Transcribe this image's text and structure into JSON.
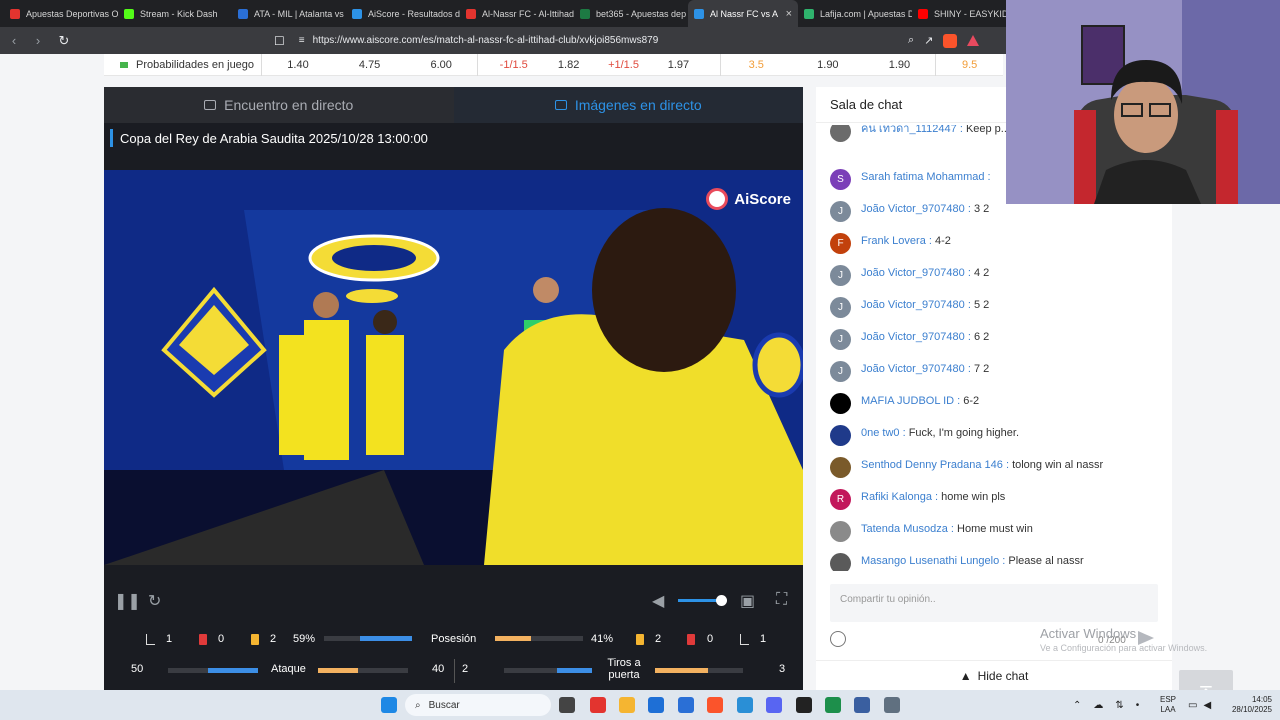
{
  "browser": {
    "tabs": [
      {
        "label": "Apuestas Deportivas O",
        "color": "#e3342f"
      },
      {
        "label": "Stream - Kick Dash",
        "color": "#53fc18"
      },
      {
        "label": "ATA - MIL | Atalanta vs",
        "color": "#2a6fd6"
      },
      {
        "label": "AiScore - Resultados d",
        "color": "#2d92e6"
      },
      {
        "label": "Al-Nassr FC - Al-Ittihad",
        "color": "#e3342f"
      },
      {
        "label": "bet365 - Apuestas dep",
        "color": "#1d7a43"
      },
      {
        "label": "Al Nassr FC vs A",
        "color": "#2d92e6"
      },
      {
        "label": "Lafija.com | Apuestas D",
        "color": "#2fb36d"
      },
      {
        "label": "SHINY - EASYKID",
        "color": "#ff0000"
      }
    ],
    "active_tab_index": 6,
    "url": "https://www.aiscore.com/es/match-al-nassr-fc-al-ittihad-club/xvkjoi856mws879"
  },
  "odds_row": {
    "label": "Probabilidades en juego",
    "values": [
      "1.40",
      "4.75",
      "6.00",
      "-1/1.5",
      "1.82",
      "+1/1.5",
      "1.97",
      "3.5",
      "1.90",
      "1.90",
      "9.5"
    ]
  },
  "match": {
    "tabs": {
      "live_match": "Encuentro en directo",
      "live_images": "Imágenes en directo"
    },
    "competition": "Copa del Rey de Arabia Saudita 2025/10/28 13:00:00",
    "video_logo": "AiScore",
    "stats": {
      "home_corners": "1",
      "home_red": "0",
      "home_yellow": "2",
      "away_corners": "1",
      "away_red": "0",
      "away_yellow": "2",
      "possession_label": "Posesión",
      "home_possession": "59%",
      "away_possession": "41%",
      "home_possession_value": 59,
      "away_possession_value": 41,
      "attack_label": "Ataque",
      "home_attack": "50",
      "away_attack": "40",
      "home_attack_value": 50,
      "away_attack_value": 40,
      "shots_label": "Tiros a puerta",
      "home_shots": "2",
      "away_shots": "3",
      "home_shots_value": 2,
      "away_shots_value": 3
    }
  },
  "chat": {
    "title": "Sala de chat",
    "messages": [
      {
        "user": "คน เทวดา_1112447",
        "text": "Keep p... fighting for the cup...waiting",
        "avatar": "",
        "avatar_color": "#6b6b6b"
      },
      {
        "user": "Sarah fatima Mohammad",
        "text": "",
        "avatar": "S",
        "avatar_color": "#7b3fb8"
      },
      {
        "user": "João Victor_9707480",
        "text": "3 2",
        "avatar": "J",
        "avatar_color": "#7c8a9a"
      },
      {
        "user": "Frank Lovera",
        "text": "4-2",
        "avatar": "F",
        "avatar_color": "#c2410c"
      },
      {
        "user": "João Victor_9707480",
        "text": "4 2",
        "avatar": "J",
        "avatar_color": "#7c8a9a"
      },
      {
        "user": "João Victor_9707480",
        "text": "5 2",
        "avatar": "J",
        "avatar_color": "#7c8a9a"
      },
      {
        "user": "João Victor_9707480",
        "text": "6 2",
        "avatar": "J",
        "avatar_color": "#7c8a9a"
      },
      {
        "user": "João Victor_9707480",
        "text": "7 2",
        "avatar": "J",
        "avatar_color": "#7c8a9a"
      },
      {
        "user": "MAFIA JUDBOL ID",
        "text": "6-2",
        "avatar": "",
        "avatar_color": "#000000"
      },
      {
        "user": "0ne tw0",
        "text": "Fuck, I'm going higher.",
        "avatar": "",
        "avatar_color": "#1f3a8a"
      },
      {
        "user": "Senthod Denny Pradana 146",
        "text": "tolong win al nassr",
        "avatar": "",
        "avatar_color": "#7a5a2a"
      },
      {
        "user": "Rafiki Kalonga",
        "text": "home win pls",
        "avatar": "R",
        "avatar_color": "#c2185b"
      },
      {
        "user": "Tatenda Musodza",
        "text": "Home must win",
        "avatar": "",
        "avatar_color": "#8a8a8a"
      },
      {
        "user": "Masango Lusenathi Lungelo",
        "text": "Please al nassr",
        "avatar": "",
        "avatar_color": "#5a5a5a"
      }
    ],
    "input_placeholder": "Compartir tu opinión..",
    "counter": "0 /200",
    "hide_label": "Hide chat"
  },
  "overlay": {
    "activate_title": "Activar Windows",
    "activate_sub": "Ve a Configuración para activar Windows."
  },
  "taskbar": {
    "search_label": "Buscar",
    "lang_top": "ESP",
    "lang_bottom": "LAA",
    "time": "14:05",
    "date": "28/10/2025"
  }
}
